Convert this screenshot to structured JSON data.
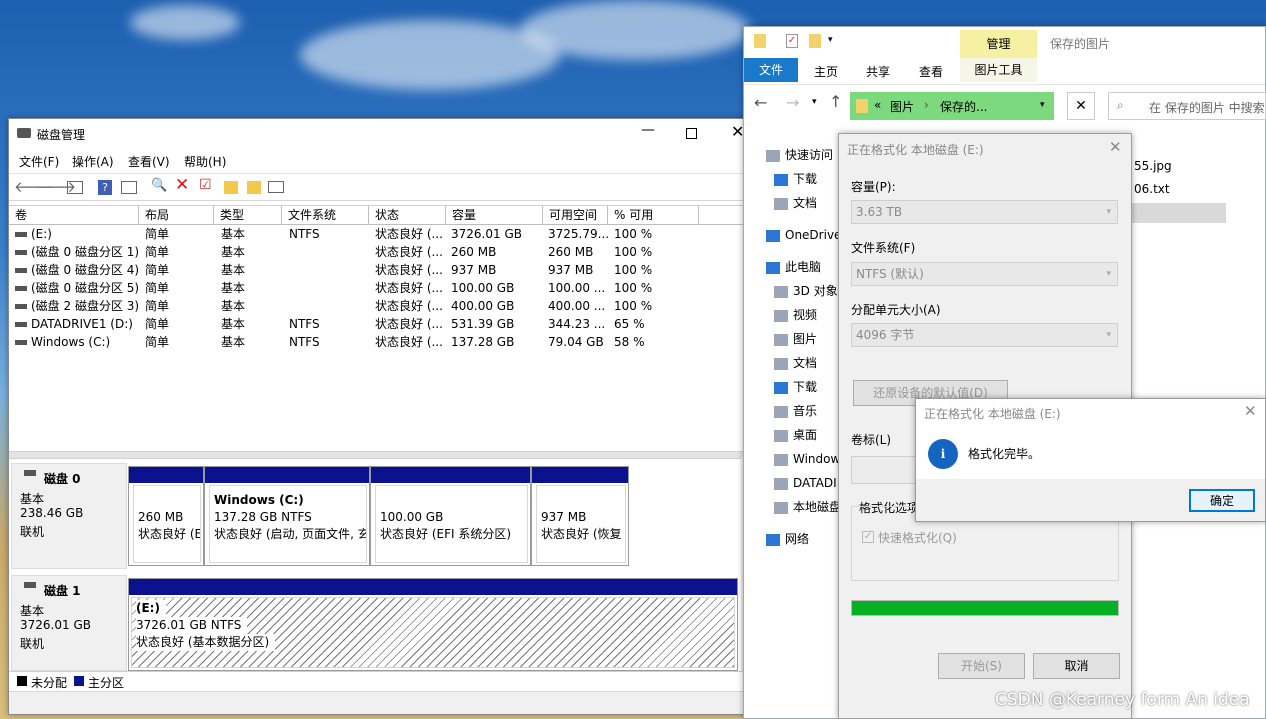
{
  "disk_mgmt": {
    "title": "磁盘管理",
    "menu": [
      "文件(F)",
      "操作(A)",
      "查看(V)",
      "帮助(H)"
    ],
    "columns": [
      "卷",
      "布局",
      "类型",
      "文件系统",
      "状态",
      "容量",
      "可用空间",
      "% 可用"
    ],
    "rows": [
      [
        "(E:)",
        "简单",
        "基本",
        "NTFS",
        "状态良好 (...",
        "3726.01 GB",
        "3725.79...",
        "100 %"
      ],
      [
        "(磁盘 0 磁盘分区 1)",
        "简单",
        "基本",
        "",
        "状态良好 (...",
        "260 MB",
        "260 MB",
        "100 %"
      ],
      [
        "(磁盘 0 磁盘分区 4)",
        "简单",
        "基本",
        "",
        "状态良好 (...",
        "937 MB",
        "937 MB",
        "100 %"
      ],
      [
        "(磁盘 0 磁盘分区 5)",
        "简单",
        "基本",
        "",
        "状态良好 (...",
        "100.00 GB",
        "100.00 ...",
        "100 %"
      ],
      [
        "(磁盘 2 磁盘分区 3)",
        "简单",
        "基本",
        "",
        "状态良好 (...",
        "400.00 GB",
        "400.00 ...",
        "100 %"
      ],
      [
        "DATADRIVE1 (D:)",
        "简单",
        "基本",
        "NTFS",
        "状态良好 (...",
        "531.39 GB",
        "344.23 ...",
        "65 %"
      ],
      [
        "Windows  (C:)",
        "简单",
        "基本",
        "NTFS",
        "状态良好 (...",
        "137.28 GB",
        "79.04 GB",
        "58 %"
      ]
    ],
    "disk0": {
      "name": "磁盘 0",
      "type": "基本",
      "size": "238.46 GB",
      "status": "联机",
      "parts": [
        {
          "title": "",
          "size": "260 MB",
          "status": "状态良好 (E"
        },
        {
          "title": "Windows  (C:)",
          "size": "137.28 GB NTFS",
          "status": "状态良好 (启动, 页面文件, 玄"
        },
        {
          "title": "",
          "size": "100.00 GB",
          "status": "状态良好 (EFI 系统分区)"
        },
        {
          "title": "",
          "size": "937 MB",
          "status": "状态良好 (恢复"
        }
      ]
    },
    "disk1": {
      "name": "磁盘 1",
      "type": "基本",
      "size": "3726.01 GB",
      "status": "联机",
      "part": {
        "title": "(E:)",
        "size": "3726.01 GB NTFS",
        "status": "状态良好 (基本数据分区)"
      }
    },
    "legend": [
      "未分配",
      "主分区"
    ]
  },
  "explorer": {
    "ribbon_manage": "管理",
    "ribbon_title": "保存的图片",
    "tabs": [
      "文件",
      "主页",
      "共享",
      "查看",
      "图片工具"
    ],
    "path": [
      "图片",
      "保存的..."
    ],
    "path_prefix": "«",
    "search_placeholder": "在 保存的图片 中搜索",
    "files": [
      "55.jpg",
      "06.txt"
    ],
    "nav": [
      "快速访问",
      "下载",
      "文档",
      "OneDrive",
      "此电脑",
      "3D 对象",
      "视频",
      "图片",
      "文档",
      "下载",
      "音乐",
      "桌面",
      "Window",
      "DATADI",
      "本地磁盘",
      "网络"
    ]
  },
  "format_dialog": {
    "title": "正在格式化 本地磁盘 (E:)",
    "capacity_label": "容量(P):",
    "capacity": "3.63 TB",
    "fs_label": "文件系统(F)",
    "fs": "NTFS (默认)",
    "alloc_label": "分配单元大小(A)",
    "alloc": "4096 字节",
    "restore_btn": "还原设备的默认值(D)",
    "volume_label": "卷标(L)",
    "options_label": "格式化选项",
    "quick_label": "快速格式化(Q)",
    "progress": 1.0,
    "start_btn": "开始(S)",
    "cancel_btn": "取消"
  },
  "message": {
    "title": "正在格式化 本地磁盘 (E:)",
    "text": "格式化完毕。",
    "ok": "确定"
  },
  "watermark": "CSDN @Kearney form An idea",
  "colors": {
    "primary_partition": "#0a128f",
    "progress": "#06b025",
    "ribbon_file": "#1979ca",
    "ribbon_manage": "#f6f0a3",
    "address_bar": "#7dd97d"
  }
}
